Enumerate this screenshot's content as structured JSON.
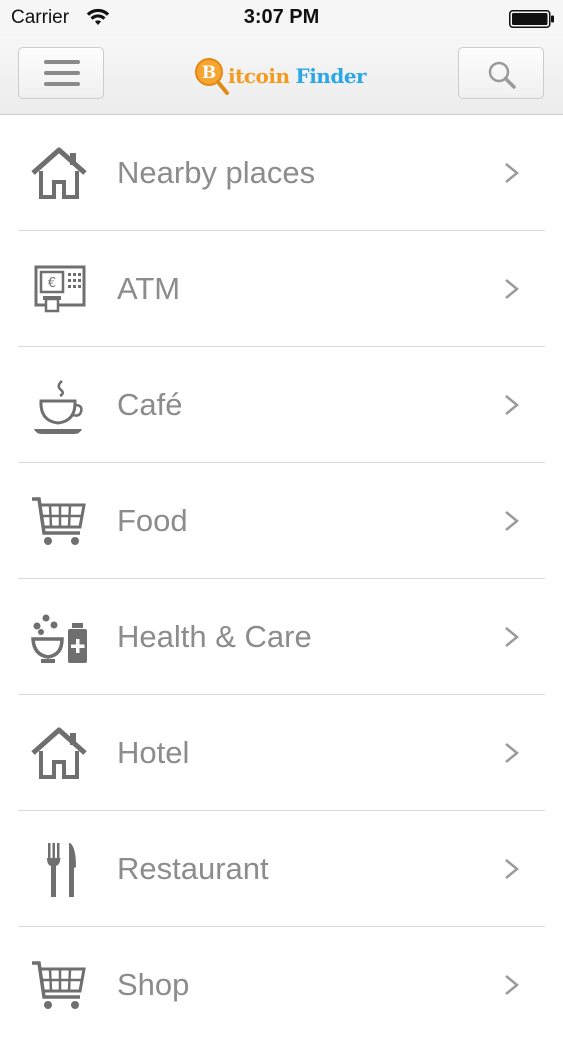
{
  "status_bar": {
    "carrier": "Carrier",
    "time": "3:07 PM"
  },
  "navbar": {
    "logo_word1": "itcoin",
    "logo_word2": "Finder",
    "logo_letter": "B"
  },
  "menu": {
    "items": [
      {
        "label": "Nearby places",
        "icon": "house-icon"
      },
      {
        "label": "ATM",
        "icon": "atm-icon"
      },
      {
        "label": "Café",
        "icon": "coffee-cup-icon"
      },
      {
        "label": "Food",
        "icon": "shopping-cart-icon"
      },
      {
        "label": "Health & Care",
        "icon": "health-care-icon"
      },
      {
        "label": "Hotel",
        "icon": "house-icon"
      },
      {
        "label": "Restaurant",
        "icon": "fork-knife-icon"
      },
      {
        "label": "Shop",
        "icon": "shopping-cart-icon"
      }
    ]
  },
  "colors": {
    "icon_gray": "#6f6f6f",
    "label_gray": "#8c8c8c",
    "logo_orange": "#f29b1f",
    "logo_blue": "#2aa7e5"
  }
}
